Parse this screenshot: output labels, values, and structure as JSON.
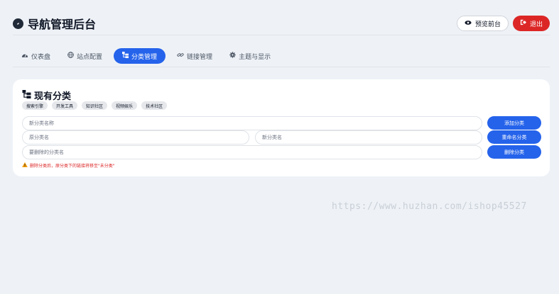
{
  "header": {
    "title": "导航管理后台",
    "preview_label": "预览前台",
    "logout_label": "退出"
  },
  "tabs": [
    {
      "label": "仪表盘",
      "icon": "gauge-icon"
    },
    {
      "label": "站点配置",
      "icon": "globe-icon"
    },
    {
      "label": "分类管理",
      "icon": "category-icon",
      "active": true
    },
    {
      "label": "链接管理",
      "icon": "link-icon"
    },
    {
      "label": "主题与显示",
      "icon": "gear-icon"
    }
  ],
  "card": {
    "title": "现有分类",
    "categories": [
      "搜索引擎",
      "开发工具",
      "知识社区",
      "视频娱乐",
      "技术社区"
    ],
    "new_category_placeholder": "新分类名称",
    "add_button": "添加分类",
    "old_name_placeholder": "原分类名",
    "new_name_placeholder": "新分类名",
    "rename_button": "重命名分类",
    "delete_placeholder": "要删除的分类名",
    "delete_button": "删除分类",
    "warning": "删除分类后，原分类下的链接将移至\"未分类\""
  },
  "watermark": "https://www.huzhan.com/ishop45527",
  "colors": {
    "primary": "#2563eb",
    "danger": "#dc2626",
    "background": "#eef2f7"
  }
}
